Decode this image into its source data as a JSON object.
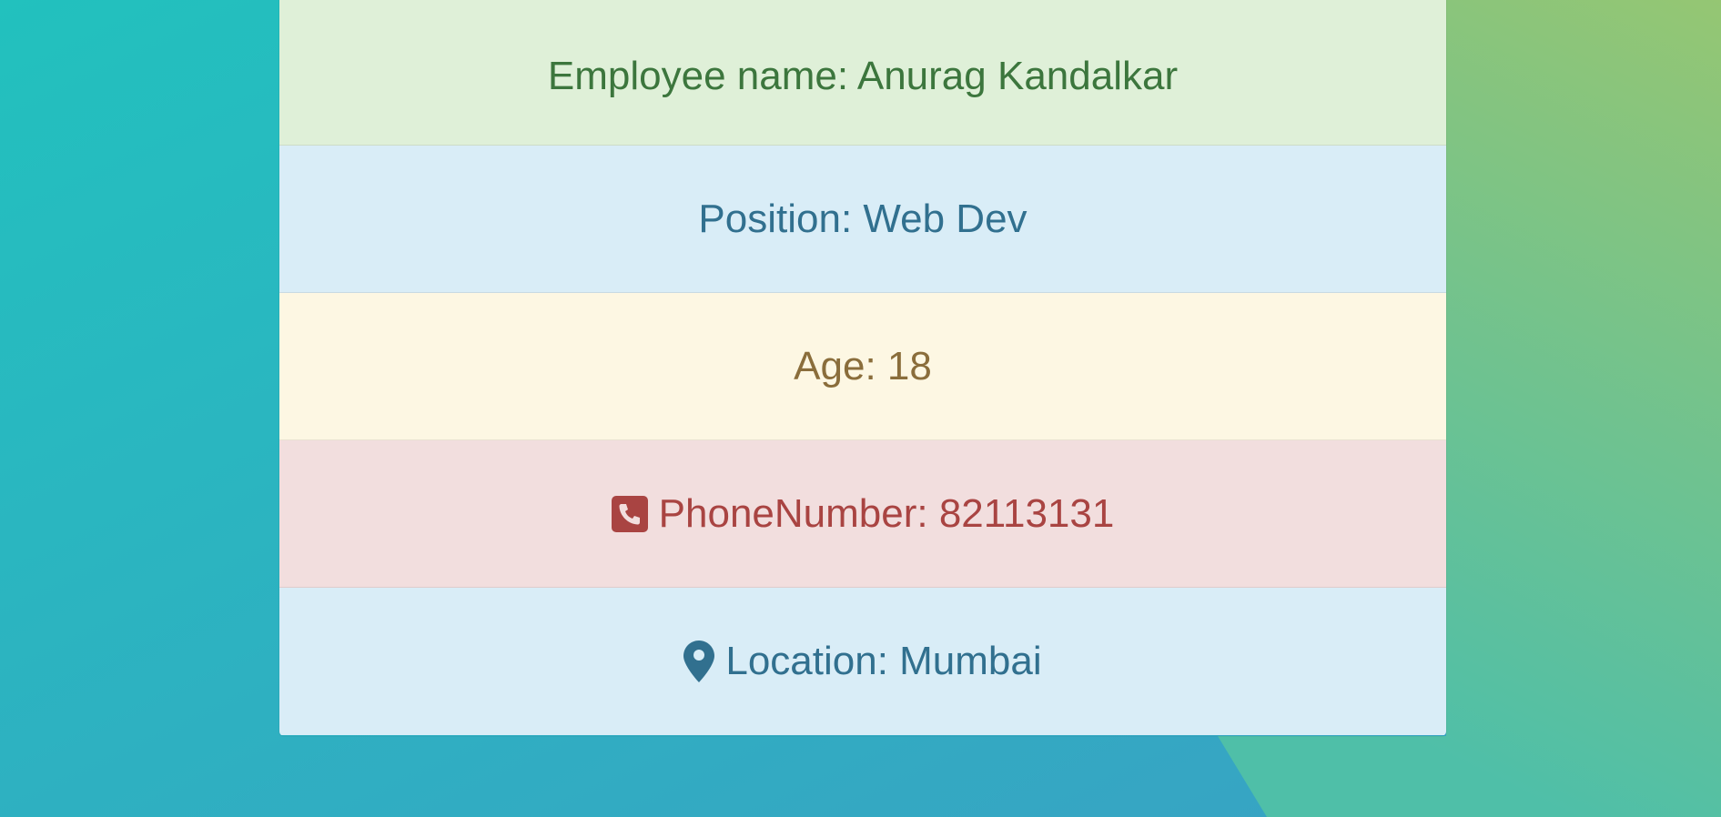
{
  "employee_card": {
    "name_label": "Employee name: Anurag Kandalkar",
    "position_label": "Position: Web Dev",
    "age_label": "Age: 18",
    "phone_label": "PhoneNumber: 82113131",
    "location_label": "Location: Mumbai"
  },
  "icons": {
    "phone": "phone-square-icon",
    "location": "map-marker-icon"
  },
  "colors": {
    "background_start": "#25c2bd",
    "background_end": "#93c572",
    "success_bg": "#dff0d8",
    "info_bg": "#d9edf7",
    "warning_bg": "#fcf8e3",
    "danger_bg": "#f2dede"
  }
}
